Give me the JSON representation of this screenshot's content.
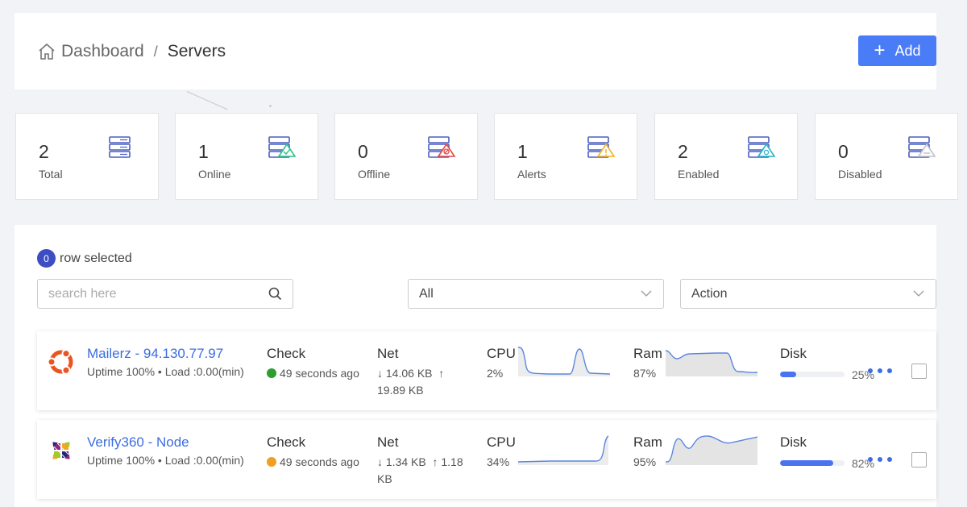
{
  "breadcrumb": {
    "home": "Dashboard",
    "separator": "/",
    "current": "Servers"
  },
  "header": {
    "add_label": "Add"
  },
  "stats": [
    {
      "value": "2",
      "label": "Total"
    },
    {
      "value": "1",
      "label": "Online"
    },
    {
      "value": "0",
      "label": "Offline"
    },
    {
      "value": "1",
      "label": "Alerts"
    },
    {
      "value": "2",
      "label": "Enabled"
    },
    {
      "value": "0",
      "label": "Disabled"
    }
  ],
  "selection": {
    "count": "0",
    "label": "row selected"
  },
  "search": {
    "placeholder": "search here"
  },
  "filters": {
    "status": "All",
    "action": "Action"
  },
  "columns": {
    "check": "Check",
    "net": "Net",
    "cpu": "CPU",
    "ram": "Ram",
    "disk": "Disk"
  },
  "servers": [
    {
      "name": "Mailerz - 94.130.77.97",
      "uptime": "Uptime 100% • Load :0.00(min)",
      "check": "49 seconds ago",
      "check_color": "#2e9e2e",
      "net_down": "↓ 14.06 KB",
      "net_up": "↑",
      "net_up_value": "19.89 KB",
      "cpu": "2%",
      "ram": "87%",
      "disk": "25%",
      "disk_fraction": 0.25
    },
    {
      "name": "Verify360 - Node",
      "uptime": "Uptime 100% • Load :0.00(min)",
      "check": "49 seconds ago",
      "check_color": "#f0a020",
      "net_down": "↓ 1.34 KB",
      "net_up": "↑ 1.18",
      "net_up_value": "KB",
      "cpu": "34%",
      "ram": "95%",
      "disk": "82%",
      "disk_fraction": 0.82
    }
  ]
}
